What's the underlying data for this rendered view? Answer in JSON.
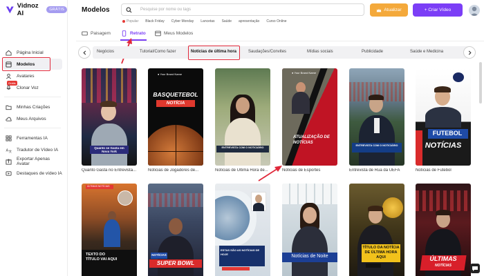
{
  "brand": {
    "name": "Vidnoz AI",
    "badge": "GRÁTIS"
  },
  "sidebar": {
    "items": [
      {
        "label": "Página Inicial",
        "icon": "home-icon"
      },
      {
        "label": "Modelos",
        "icon": "template-icon"
      },
      {
        "label": "Avatares",
        "icon": "avatar-icon"
      },
      {
        "label": "Clonar Voz",
        "icon": "voice-icon"
      },
      {
        "label": "Minhas Criações",
        "icon": "folder-icon"
      },
      {
        "label": "Meus Arquivos",
        "icon": "cloud-icon"
      },
      {
        "label": "Ferramentas IA",
        "icon": "tools-icon"
      },
      {
        "label": "Tradutor de Vídeo IA",
        "icon": "translate-icon"
      },
      {
        "label": "Exportar Apenas Avatar",
        "icon": "export-icon"
      },
      {
        "label": "Destaques de vídeo IA",
        "icon": "highlight-icon"
      }
    ],
    "new_tag": "Grátis"
  },
  "header": {
    "title": "Modelos",
    "search_placeholder": "Pesquise por nome ou tags",
    "upgrade_label": "Atualizar",
    "create_label": "+ Criar Vídeo",
    "trending_label": "Popular",
    "trending": [
      "Black Friday",
      "Cyber Monday",
      "Lancetas",
      "Saúde",
      "apresentação",
      "Curso Online"
    ]
  },
  "format_tabs": [
    {
      "label": "Paisagem",
      "icon": "landscape-icon"
    },
    {
      "label": "Retrato",
      "icon": "portrait-icon",
      "active": true
    },
    {
      "label": "Meus Modelos",
      "icon": "my-templates-icon"
    }
  ],
  "categories": [
    "Negócios",
    "Tutorial/Como fazer",
    "Notícias de última hora",
    "Saudações/Convites",
    "Mídias sociais",
    "Publicidade",
    "Saúde e Medicina"
  ],
  "active_category": "Notícias de última hora",
  "cards": [
    {
      "label": "Quanto Gasta no Entrevista...",
      "overlay": "Quanto se Gasta em Nova York"
    },
    {
      "label": "Notícias de Jogadores de...",
      "overlay": "BASQUETEBOL",
      "overlay2": "NOTÍCIA"
    },
    {
      "label": "Notícias de Última Hora de...",
      "overlay": "ENTREVISTA COM O NOTICIÁRIO"
    },
    {
      "label": "Notícias de Esportes",
      "overlay": "ATUALIZAÇÃO DE NOTÍCIAS"
    },
    {
      "label": "Entrevista de Rua da UEFA",
      "overlay": "ENTREVISTA COM O NOTICIÁRIO"
    },
    {
      "label": "Notícias de Futebol",
      "overlay": "FUTEBOL",
      "overlay2": "NOTÍCIAS"
    },
    {
      "label": "",
      "overlay": "TEXTO DO TÍTULO VAI AQUI",
      "tag": "ÚLTIMAS NOTÍCIAS"
    },
    {
      "label": "",
      "overlay": "NOTÍCIAS",
      "overlay2": "SUPER BOWL"
    },
    {
      "label": "",
      "overlay": "ESTAS SÃO AS NOTÍCIAS DE HOJE"
    },
    {
      "label": "",
      "overlay": "Notícias de Noite"
    },
    {
      "label": "",
      "overlay": "TÍTULO DA NOTÍCIA DE ÚLTIMA HORA AQUI"
    },
    {
      "label": "",
      "overlay": "ÚLTIMAS",
      "overlay2": "NOTÍCIAS"
    }
  ],
  "colors": {
    "accent": "#7b3ef6",
    "upgrade": "#f4a93b",
    "annotation": "#e0283a"
  }
}
